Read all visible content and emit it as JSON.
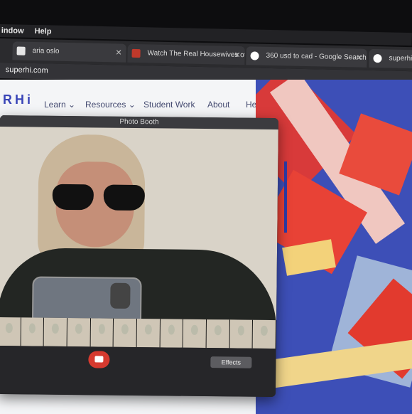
{
  "menu": {
    "items": [
      "indow",
      "Help"
    ]
  },
  "tabs": [
    {
      "label": "aria oslo",
      "favicon": "bookmark-icon"
    },
    {
      "label": "Watch The Real Housewives of",
      "favicon": "tv-icon"
    },
    {
      "label": "360 usd to cad - Google Search",
      "favicon": "google-icon"
    },
    {
      "label": "superhi",
      "favicon": "google-icon"
    }
  ],
  "address": {
    "url": "superhi.com"
  },
  "site": {
    "logo": "RHi",
    "nav": [
      "Learn ⌄",
      "Resources ⌄",
      "Student Work",
      "About",
      "Help"
    ]
  },
  "photo_booth": {
    "title": "Photo Booth",
    "effects_label": "Effects",
    "thumbnail_count": 12
  },
  "colors": {
    "accent": "#3a45b7",
    "shutter": "#d63a2f"
  }
}
